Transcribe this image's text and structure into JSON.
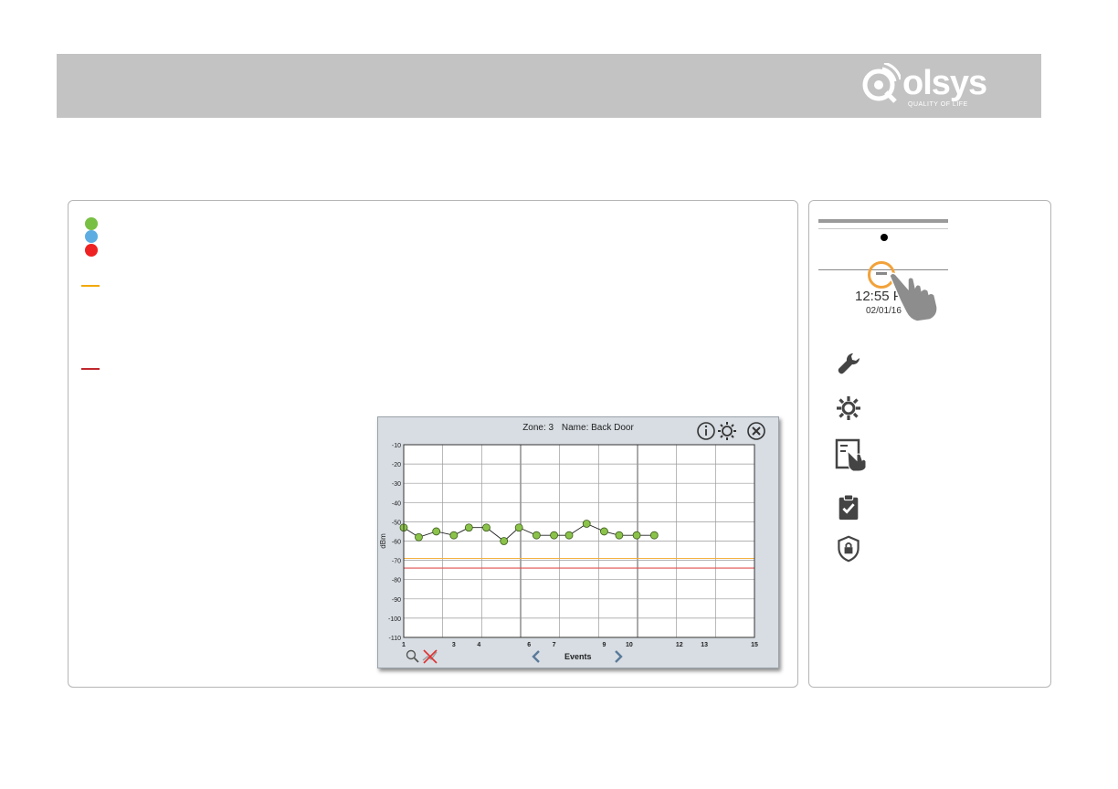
{
  "brand": {
    "name": "Qolsys",
    "wordmark": "olsys",
    "tagline": "QUALITY OF LIFE",
    "banner_color": "#c3c3c3"
  },
  "legend": {
    "dot_colors": [
      "#78c043",
      "#5dade2",
      "#ee2222"
    ],
    "line_colors": [
      "#f2a900",
      "#c0282e"
    ]
  },
  "chart_screen": {
    "zone_label": "Zone: 3",
    "name_label": "Name: Back Door",
    "info_icon": "info-icon",
    "settings_icon": "gear-icon",
    "close_icon": "close-icon",
    "zoom_icon": "zoom-icon",
    "clear_icon": "clear-icon",
    "prev_icon": "chevron-left-icon",
    "next_icon": "chevron-right-icon",
    "events_label": "Events"
  },
  "chart_data": {
    "type": "line",
    "title": "Zone: 3   Name: Back Door",
    "xlabel": "Events",
    "ylabel": "dBm",
    "xlim": [
      1,
      15
    ],
    "ylim": [
      -110,
      -10
    ],
    "x_ticks": [
      1,
      3,
      4,
      6,
      7,
      9,
      10,
      12,
      13,
      15
    ],
    "y_ticks": [
      -10,
      -20,
      -30,
      -40,
      -50,
      -60,
      -70,
      -80,
      -90,
      -100,
      -110
    ],
    "grid": true,
    "series": [
      {
        "color": "#8bc34a",
        "x": [
          1,
          1.6,
          2.3,
          3,
          3.6,
          4.3,
          5,
          5.6,
          6.3,
          7,
          7.6,
          8.3,
          9,
          9.6,
          10.3,
          11
        ],
        "y": [
          -53,
          -58,
          -55,
          -57,
          -53,
          -53,
          -60,
          -53,
          -57,
          -57,
          -57,
          -51,
          -55,
          -57,
          -57,
          -57
        ]
      }
    ],
    "reference_lines": [
      {
        "color": "#f5b041",
        "y": -69
      },
      {
        "color": "#e05050",
        "y": -74
      }
    ]
  },
  "sidebar": {
    "clock_time": "12:55 P",
    "clock_date": "02/01/16",
    "icons": [
      "wrench-icon",
      "gear-icon",
      "touch-panel-icon",
      "clipboard-check-icon",
      "shield-lock-icon"
    ]
  }
}
